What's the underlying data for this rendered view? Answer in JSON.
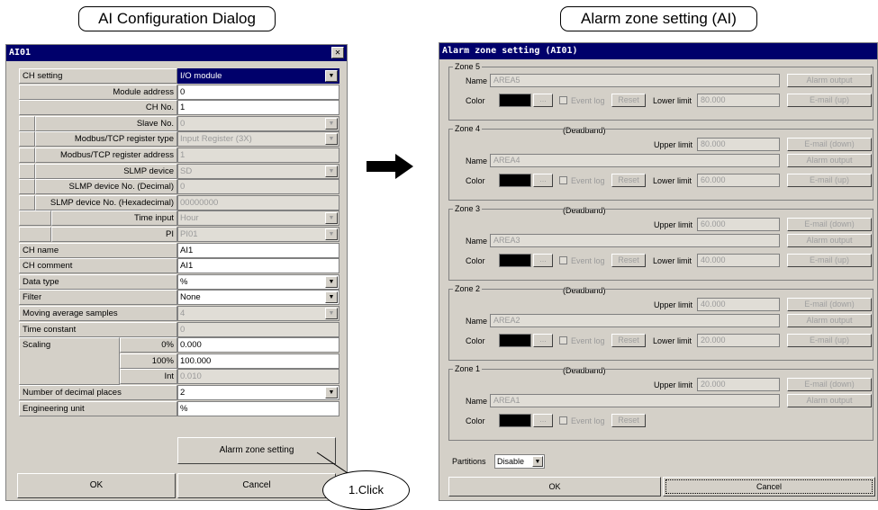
{
  "captions": {
    "left": "AI Configuration Dialog",
    "right": "Alarm zone setting (AI)"
  },
  "callout": "1.Click",
  "ai_dialog": {
    "title": "AI01",
    "close": "✕",
    "rows": [
      {
        "label": "CH setting",
        "value": "I/O module",
        "state": "selected",
        "dropdown": true
      },
      {
        "label": "Module address",
        "value": "0",
        "state": "normal"
      },
      {
        "label": "CH No.",
        "value": "1",
        "state": "normal"
      },
      {
        "label": "Slave No.",
        "value": "0",
        "state": "disabled",
        "dropdown": true
      },
      {
        "label": "Modbus/TCP register type",
        "value": "Input Register (3X)",
        "state": "disabled",
        "dropdown": true
      },
      {
        "label": "Modbus/TCP register address",
        "value": "1",
        "state": "disabled"
      },
      {
        "label": "SLMP device",
        "value": "SD",
        "state": "disabled",
        "dropdown": true
      },
      {
        "label": "SLMP device No. (Decimal)",
        "value": "0",
        "state": "disabled"
      },
      {
        "label": "SLMP device No. (Hexadecimal)",
        "value": "00000000",
        "state": "disabled"
      },
      {
        "label": "Time input",
        "value": "Hour",
        "state": "disabled",
        "dropdown": true
      },
      {
        "label": "PI",
        "value": "PI01",
        "state": "disabled",
        "dropdown": true
      },
      {
        "label": "CH name",
        "value": "AI1",
        "state": "normal"
      },
      {
        "label": "CH comment",
        "value": "AI1",
        "state": "normal"
      },
      {
        "label": "Data type",
        "value": "%",
        "state": "normal",
        "dropdown": true
      },
      {
        "label": "Filter",
        "value": "None",
        "state": "normal",
        "dropdown": true
      },
      {
        "label": "Moving average samples",
        "value": "4",
        "state": "disabled",
        "dropdown": true
      },
      {
        "label": "Time constant",
        "value": "0",
        "state": "disabled"
      },
      {
        "label": "0%",
        "group": "Scaling",
        "value": "0.000",
        "state": "normal"
      },
      {
        "label": "100%",
        "value": "100.000",
        "state": "normal"
      },
      {
        "label": "Int",
        "value": "0.010",
        "state": "disabled"
      },
      {
        "label": "Number of decimal places",
        "value": "2",
        "state": "normal",
        "dropdown": true
      },
      {
        "label": "Engineering unit",
        "value": "%",
        "state": "normal"
      }
    ],
    "alarm_zone_button": "Alarm zone setting",
    "ok": "OK",
    "cancel": "Cancel"
  },
  "alarm_dialog": {
    "title": "Alarm zone setting (AI01)",
    "labels": {
      "name": "Name",
      "color": "Color",
      "upper": "Upper limit",
      "lower": "Lower limit",
      "deadband": "(Deadband)",
      "event_log": "Event log",
      "reset": "Reset",
      "ellipsis": "...",
      "alarm_output": "Alarm output",
      "email_up": "E-mail (up)",
      "email_down": "E-mail (down)",
      "partitions": "Partitions"
    },
    "zones": [
      {
        "title": "Zone 5",
        "name": "AREA5",
        "lower": "80.000"
      },
      {
        "title": "Zone 4",
        "name": "AREA4",
        "upper": "80.000",
        "lower": "60.000"
      },
      {
        "title": "Zone 3",
        "name": "AREA3",
        "upper": "60.000",
        "lower": "40.000"
      },
      {
        "title": "Zone 2",
        "name": "AREA2",
        "upper": "40.000",
        "lower": "20.000"
      },
      {
        "title": "Zone 1",
        "name": "AREA1",
        "upper": "20.000"
      }
    ],
    "partitions_value": "Disable",
    "ok": "OK",
    "cancel": "Cancel"
  },
  "colors": {
    "titlebar": "#00006b",
    "dialog_bg": "#d4d0c8",
    "swatch": "#000000"
  }
}
